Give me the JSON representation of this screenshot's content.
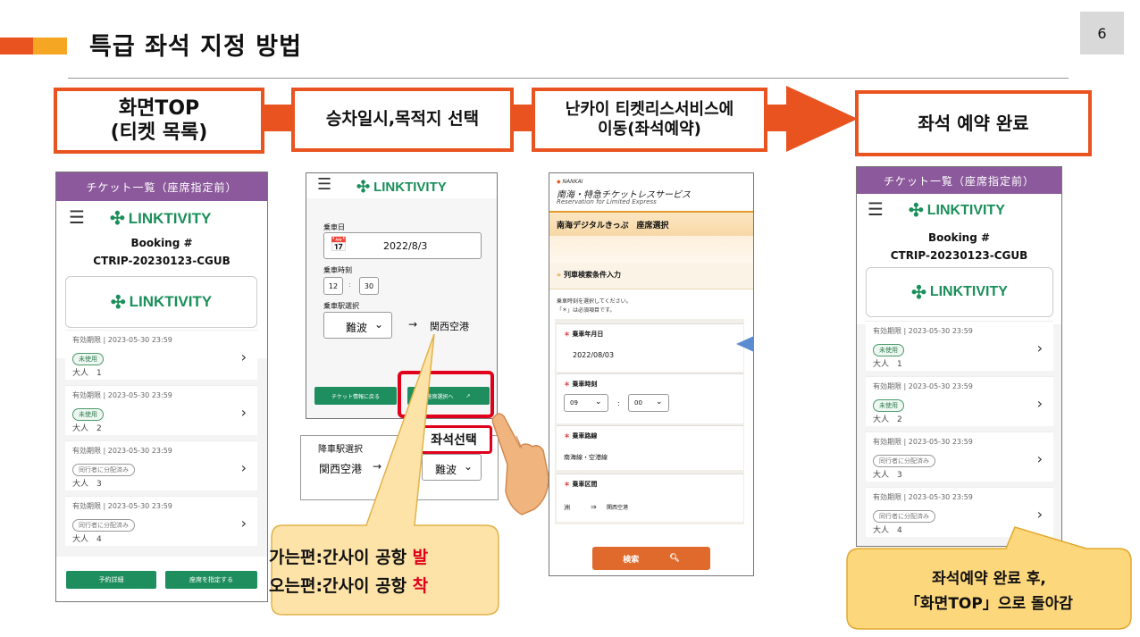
{
  "header": {
    "title": "특급 좌석 지정 방법",
    "page_number": "6"
  },
  "steps": [
    {
      "line1": "화면TOP",
      "line2": "(티켓 목록)"
    },
    {
      "line1": "승차일시,목적지 선택"
    },
    {
      "line1": "난카이 티켓리스서비스에",
      "line2": "이동(좌석예약)"
    },
    {
      "line1": "좌석 예약 완료"
    }
  ],
  "ticket_list": {
    "header": "チケット一覧（座席指定前）",
    "brand": "LINKTIVITY",
    "booking_label": "Booking #",
    "booking_id": "CTRIP-20230123-CGUB",
    "tickets": [
      {
        "validity": "有効期限 | 2023-05-30 23:59",
        "status": "未使用",
        "pax": "大人　1"
      },
      {
        "validity": "有効期限 | 2023-05-30 23:59",
        "status": "未使用",
        "pax": "大人　2"
      },
      {
        "validity": "有効期限 | 2023-05-30 23:59",
        "status": "同行者に分配済み",
        "pax": "大人　3"
      },
      {
        "validity": "有効期限 | 2023-05-30 23:59",
        "status": "同行者に分配済み",
        "pax": "大人　4"
      }
    ],
    "btn_detail": "予約詳細",
    "btn_seat": "座席を指定する"
  },
  "select": {
    "brand": "LINKTIVITY",
    "date_label": "乗車日",
    "date_value": "2022/8/3",
    "time_label": "乗車時刻",
    "hour": "12",
    "minute": "30",
    "colon": ":",
    "station_label": "乗車駅選択",
    "station": "難波",
    "arrow": "→",
    "destination": "関西空港",
    "btn_back": "チケット情報に戻る",
    "btn_seat": "座席選択へ",
    "highlight_label": "좌석선택",
    "return_label": "降車駅選択",
    "return_from": "関西空港",
    "return_to": "難波"
  },
  "nankai": {
    "brand_small": "NANKAI",
    "brand_title": "南海・特急チケットレスサービス",
    "brand_sub": "Reservation for Limited Express",
    "page_title": "南海デジタルきっぷ　座席選択",
    "section": "列車検索条件入力",
    "note1": "乗車時刻を選択してください。",
    "note2": "「＊」は必須項目です。",
    "date_label": "乗車年月日",
    "date_value": "2022/08/03",
    "time_label": "乗車時刻",
    "hour": "09",
    "minute": "00",
    "route_label": "乗車路線",
    "route_value": "南海線・空港線",
    "section_label": "乗車区間",
    "from": "洲",
    "to_arrow": "⇒",
    "to": "関西空港",
    "search_btn": "検索"
  },
  "done": {
    "header": "チケット一覧（座席指定前）",
    "brand": "LINKTIVITY",
    "booking_label": "Booking #",
    "booking_id": "CTRIP-20230123-CGUB",
    "tickets": [
      {
        "validity": "有効期限 | 2023-05-30 23:59",
        "status": "未使用",
        "pax": "大人　1"
      },
      {
        "validity": "有効期限 | 2023-05-30 23:59",
        "status": "未使用",
        "pax": "大人　2"
      },
      {
        "validity": "有効期限 | 2023-05-30 23:59",
        "status": "同行者に分配済み",
        "pax": "大人　3"
      },
      {
        "validity": "有効期限 | 2023-05-30 23:59",
        "status": "同行者に分配済み",
        "pax": "大人　4"
      }
    ]
  },
  "callouts": {
    "going_prefix": "가는편:간사이 공항 ",
    "going_suffix": "발",
    "return_prefix": "오는편:간사이 공항 ",
    "return_suffix": "착",
    "done_line1": "좌석예약 완료 후,",
    "done_line2": "「화면TOP」으로 돌아감"
  },
  "colors": {
    "accent": "#e8531f",
    "brand": "#1a8f5a",
    "header_purple": "#8c5a9c",
    "highlight_red": "#e0001b"
  }
}
